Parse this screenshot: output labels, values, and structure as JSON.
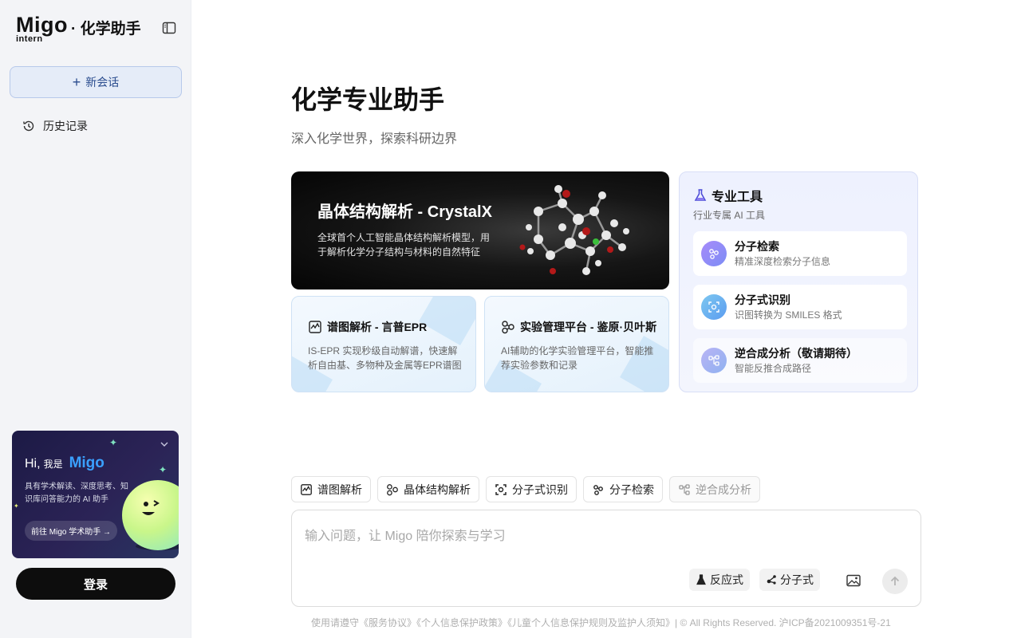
{
  "app": {
    "logo_text": "Migo",
    "logo_sub_text": "intern",
    "logo_suffix": "· 化学助手"
  },
  "sidebar": {
    "new_chat_label": "新会话",
    "history_label": "历史记录",
    "promo": {
      "greeting": "Hi,",
      "greeting_small": "我是",
      "brand": "Migo",
      "description": "具有学术解读、深度思考、知识库问答能力的 AI 助手",
      "button_label": "前往 Migo 学术助手 →"
    },
    "login_label": "登录"
  },
  "main": {
    "title": "化学专业助手",
    "subtitle": "深入化学世界，探索科研边界",
    "crystal_card": {
      "title": "晶体结构解析 - CrystalX",
      "description": "全球首个人工智能晶体结构解析模型，用于解析化学分子结构与材料的自然特征"
    },
    "epr_card": {
      "title": "谱图解析 - 言普EPR",
      "description": "IS-EPR 实现秒级自动解谱，快速解析自由基、多物种及金属等EPR谱图"
    },
    "lab_card": {
      "title": "实验管理平台 - 鉴原·贝叶斯",
      "description": "AI辅助的化学实验管理平台，智能推荐实验参数和记录"
    },
    "tools": {
      "title": "专业工具",
      "subtitle": "行业专属 AI 工具",
      "items": [
        {
          "name": "分子检索",
          "desc": "精准深度检索分子信息"
        },
        {
          "name": "分子式识别",
          "desc": "识图转换为 SMILES 格式"
        },
        {
          "name": "逆合成分析（敬请期待）",
          "desc": "智能反推合成路径"
        }
      ]
    }
  },
  "chips": [
    "谱图解析",
    "晶体结构解析",
    "分子式识别",
    "分子检索",
    "逆合成分析"
  ],
  "input": {
    "placeholder": "输入问题，让 Migo 陪你探索与学习",
    "value": "",
    "reaction_label": "反应式",
    "molecule_label": "分子式"
  },
  "footer": {
    "text": "使用请遵守《服务协议》《个人信息保护政策》《儿童个人信息保护规则及监护人须知》| © All Rights Reserved. 沪ICP备2021009351号-21"
  },
  "colors": {
    "accent": "#1aa3ff",
    "sidebar_bg": "#f3f4f7",
    "new_chat_bg": "#e5ecf8",
    "login_bg": "#0d0d0d"
  }
}
